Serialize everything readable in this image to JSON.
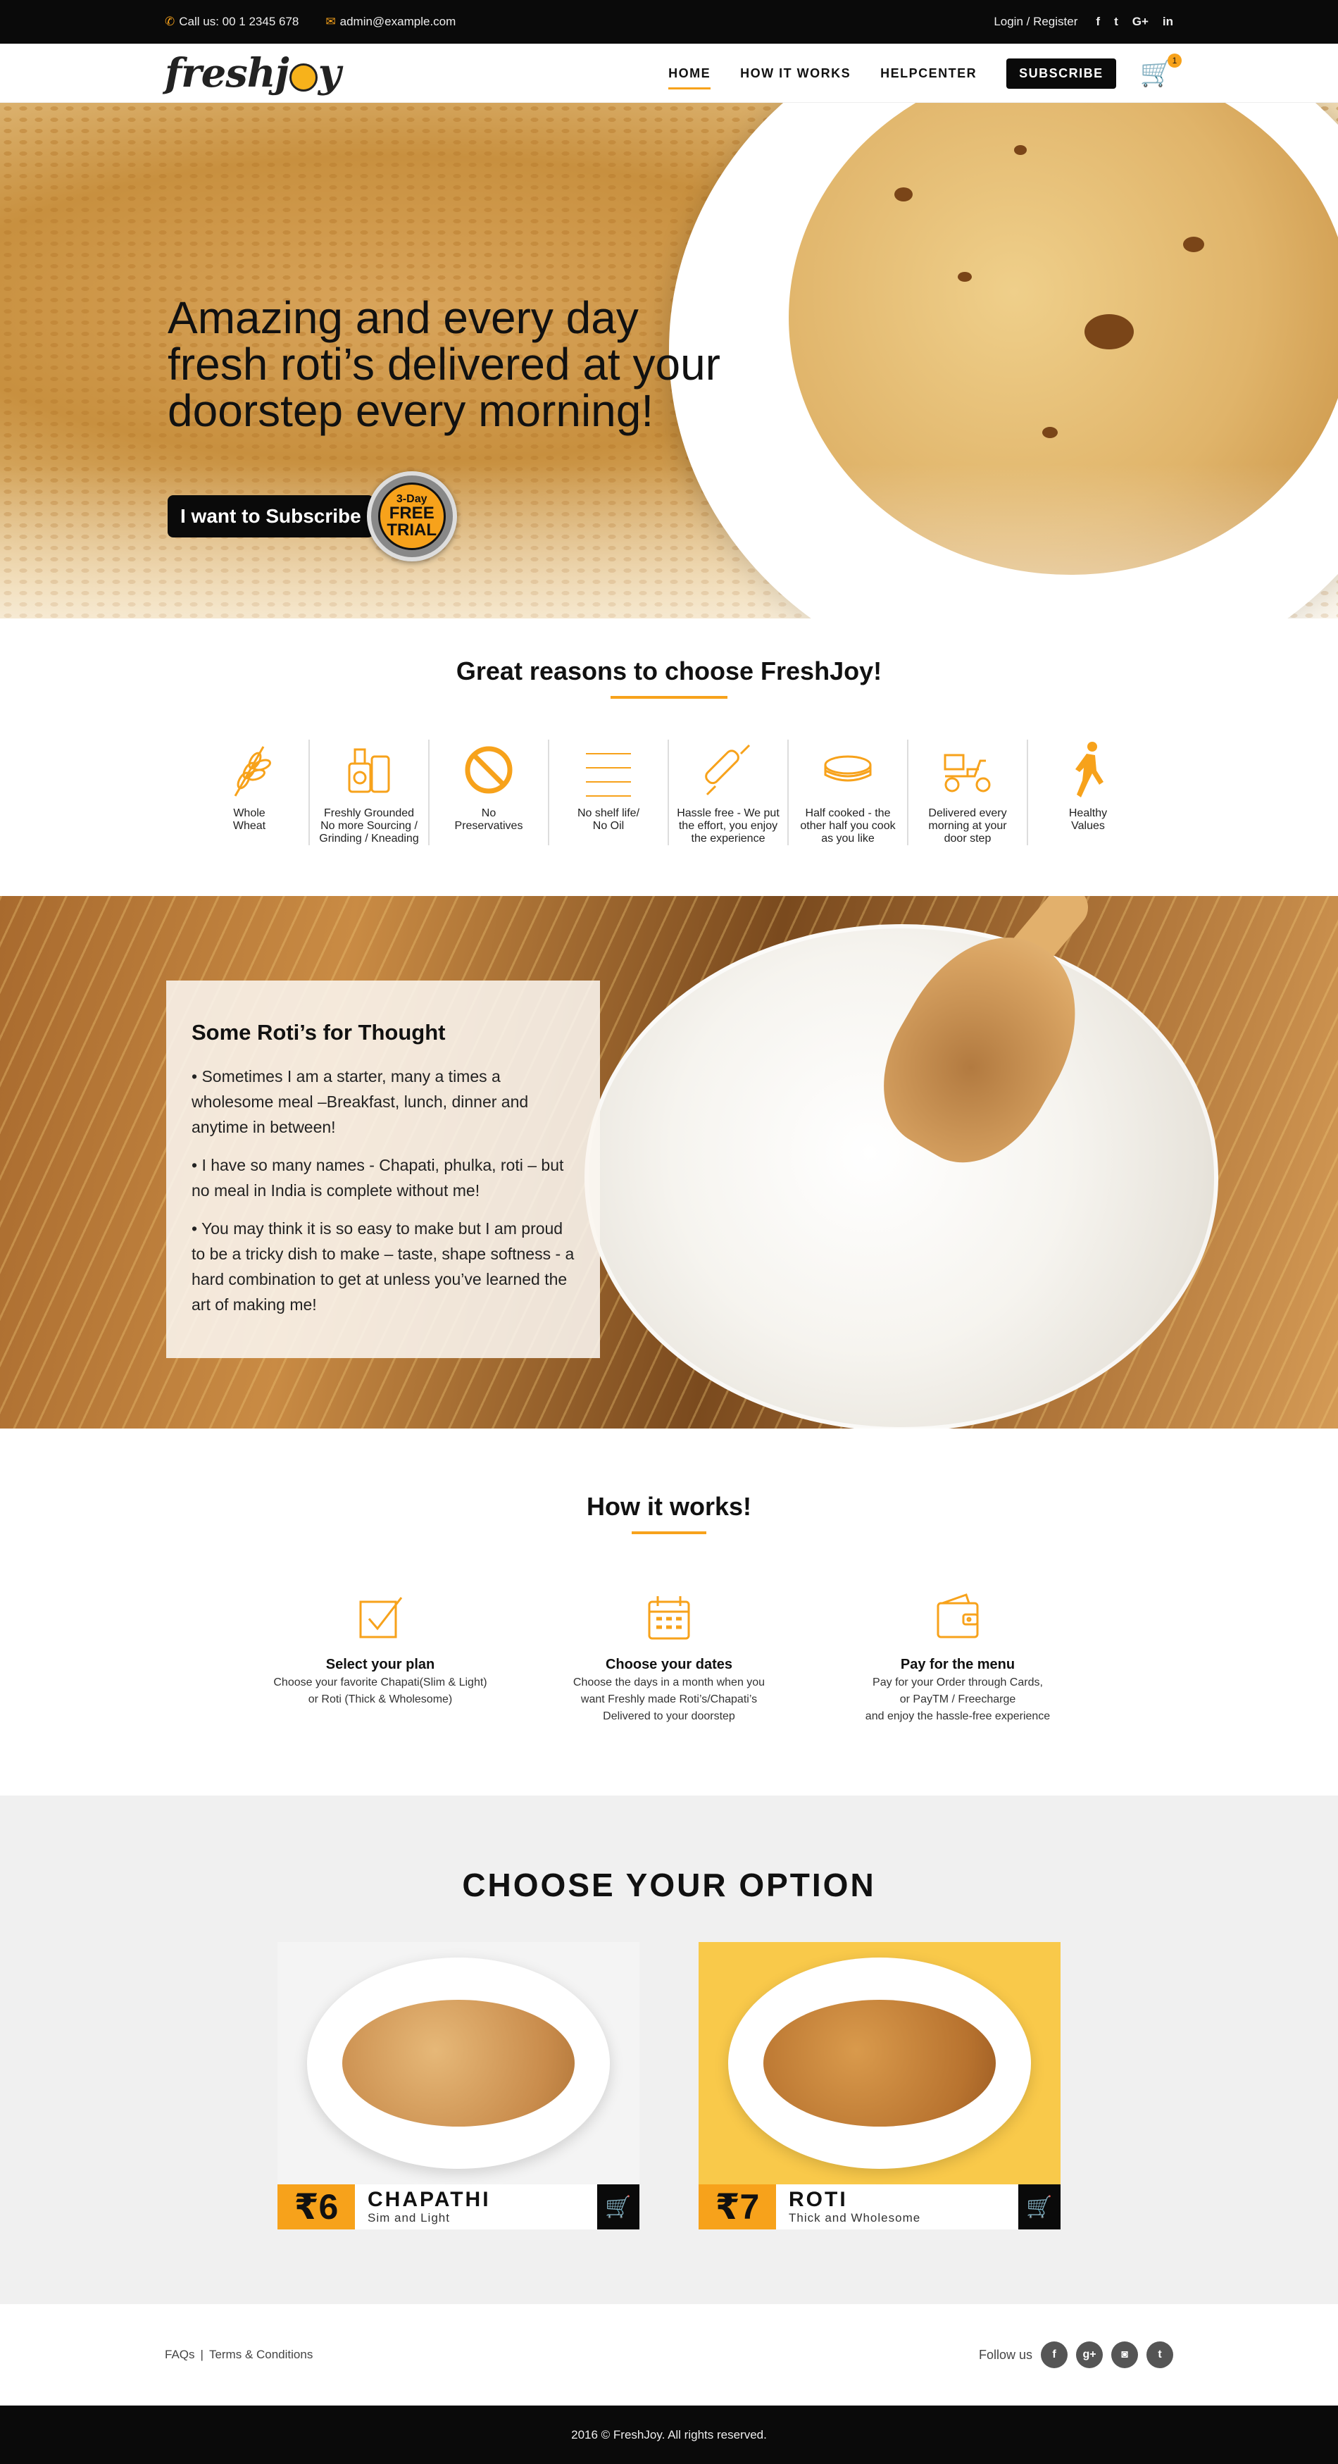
{
  "topbar": {
    "call": "Call us: 00 1 2345 678",
    "email": "admin@example.com",
    "login": "Login / Register",
    "social": [
      "f",
      "t",
      "G+",
      "in"
    ]
  },
  "nav": {
    "logo": "freshjoy",
    "items": [
      "HOME",
      "HOW IT WORKS",
      "HELPCENTER"
    ],
    "subscribe": "SUBSCRIBE",
    "cart_count": "1"
  },
  "hero": {
    "line1": "Amazing and every day",
    "line2": "fresh roti’s delivered at your",
    "line3": "doorstep every morning!",
    "button": "I want to Subscribe",
    "trial_top": "3-Day",
    "trial_free": "FREE",
    "trial_trial": "TRIAL"
  },
  "reasons": {
    "title": "Great reasons to choose FreshJoy!",
    "items": [
      {
        "icon": "wheat-icon",
        "label": "Whole\nWheat"
      },
      {
        "icon": "grinder-icon",
        "label": "Freshly Grounded\nNo more Sourcing /\nGrinding / Kneading"
      },
      {
        "icon": "no-icon",
        "label": "No\nPreservatives"
      },
      {
        "icon": "lines-icon",
        "label": "No shelf life/\nNo Oil"
      },
      {
        "icon": "rolling-pin-icon",
        "label": "Hassle free - We put\nthe effort, you enjoy\nthe experience"
      },
      {
        "icon": "roti-stack-icon",
        "label": "Half cooked - the\nother half you cook\nas you like"
      },
      {
        "icon": "scooter-icon",
        "label": "Delivered every\nmorning at your\ndoor step"
      },
      {
        "icon": "runner-icon",
        "label": "Healthy\nValues"
      }
    ]
  },
  "thought": {
    "title": "Some Roti’s for Thought",
    "p1": "• Sometimes I am a starter, many a times a wholesome meal –Breakfast, lunch, dinner and anytime in between!",
    "p2": "• I have so many names - Chapati, phulka, roti – but no meal in India is complete without me!",
    "p3": "• You may think it is so easy to make but I am proud to be a tricky dish to make – taste, shape softness - a hard combination to get at unless you’ve learned the art of making me!"
  },
  "how": {
    "title": "How it works!",
    "steps": [
      {
        "title": "Select your plan",
        "text": "Choose your favorite Chapati(Slim & Light)\nor Roti (Thick & Wholesome)"
      },
      {
        "title": "Choose your dates",
        "text": "Choose the days in a month when you\nwant Freshly made Roti’s/Chapati’s\nDelivered to your doorstep"
      },
      {
        "title": "Pay for the menu",
        "text": "Pay for your Order through Cards,\nor PayTM / Freecharge\nand enjoy the hassle-free experience"
      }
    ]
  },
  "options": {
    "title": "CHOOSE YOUR OPTION",
    "cards": [
      {
        "price": "₹6",
        "name": "CHAPATHI",
        "desc": "Sim and Light",
        "bg": "#f4f4f4"
      },
      {
        "price": "₹7",
        "name": "ROTI",
        "desc": "Thick and Wholesome",
        "bg": "#f9c94a"
      }
    ]
  },
  "footer": {
    "faqs": "FAQs",
    "sep": "|",
    "terms": "Terms & Conditions",
    "follow": "Follow us",
    "social": [
      "f",
      "g+",
      "◙",
      "t"
    ],
    "copyright": "2016 ©  FreshJoy. All rights reserved."
  },
  "colors": {
    "accent": "#f7a21b",
    "dark": "#0a0a0a"
  }
}
